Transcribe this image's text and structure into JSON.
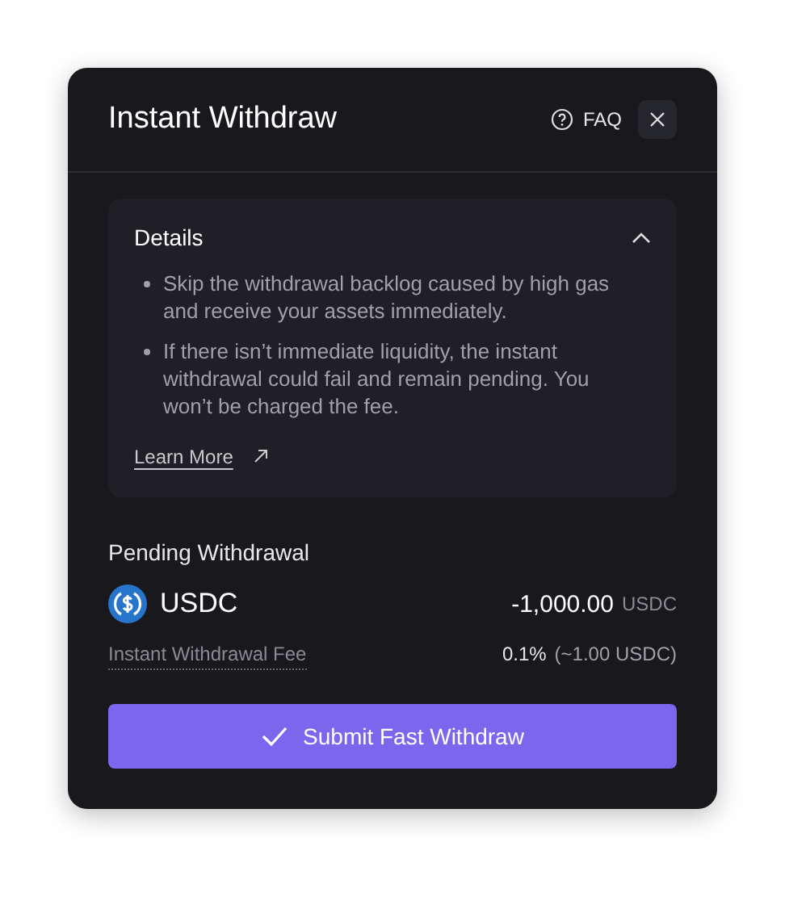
{
  "dialog": {
    "title": "Instant Withdraw",
    "faq_label": "FAQ"
  },
  "details": {
    "title": "Details",
    "expanded": true,
    "bullets": [
      "Skip the withdrawal backlog caused by high gas and receive your assets immediately.",
      "If there isn’t immediate liquidity, the instant withdrawal could fail and remain pending. You won’t be charged the fee."
    ],
    "link": "Learn More"
  },
  "pending": {
    "label": "Pending Withdrawal",
    "asset": "USDC",
    "amount": "-1,000.00",
    "amount_unit": "USDC"
  },
  "fee": {
    "label": "Instant Withdrawal Fee",
    "rate": "0.1%",
    "estimate": "(~1.00 USDC)"
  },
  "submit": {
    "label": "Submit Fast Withdraw"
  }
}
